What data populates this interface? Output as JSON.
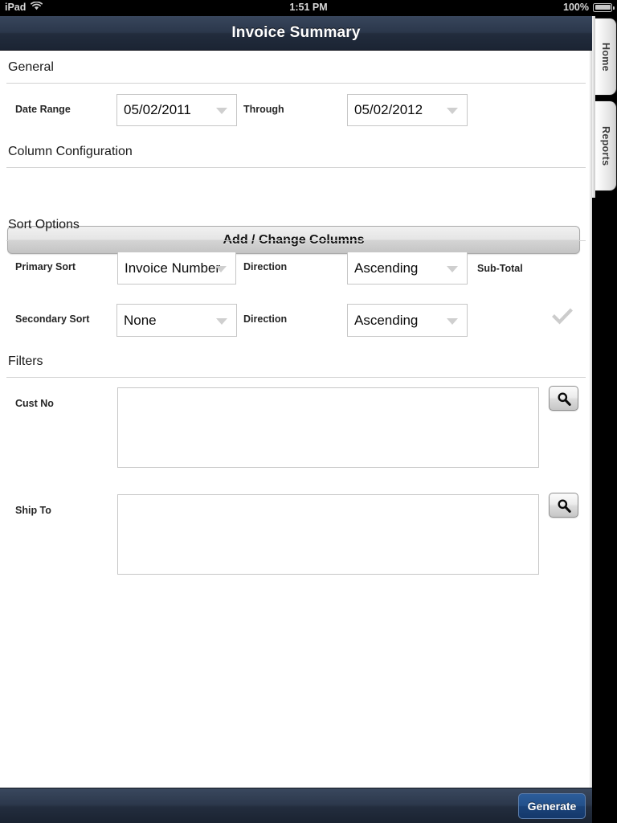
{
  "status_bar": {
    "carrier": "iPad",
    "wifi_icon": "wifi-icon",
    "time": "1:51 PM",
    "battery_percent": "100%",
    "battery_icon": "battery-full-icon"
  },
  "nav": {
    "title": "Invoice Summary"
  },
  "side_tabs": [
    {
      "label": "Home"
    },
    {
      "label": "Reports"
    }
  ],
  "sections": {
    "general": {
      "title": "General",
      "date_range_label": "Date Range",
      "date_from": "05/02/2011",
      "through_label": "Through",
      "date_to": "05/02/2012"
    },
    "column_configuration": {
      "title": "Column Configuration",
      "button_label": "Add / Change Columns"
    },
    "sort_options": {
      "title": "Sort Options",
      "primary_sort_label": "Primary Sort",
      "primary_sort_value": "Invoice Number",
      "primary_direction_label": "Direction",
      "primary_direction_value": "Ascending",
      "sub_total_label": "Sub-Total",
      "sub_total_icon": "checkmark-icon",
      "secondary_sort_label": "Secondary Sort",
      "secondary_sort_value": "None",
      "secondary_direction_label": "Direction",
      "secondary_direction_value": "Ascending"
    },
    "filters": {
      "title": "Filters",
      "cust_no_label": "Cust No",
      "cust_no_value": "",
      "cust_no_search_icon": "search-icon",
      "ship_to_label": "Ship To",
      "ship_to_value": "",
      "ship_to_search_icon": "search-icon"
    }
  },
  "toolbar": {
    "generate_label": "Generate"
  },
  "colors": {
    "nav_bar": "#2b374b",
    "accent_button": "#23508a",
    "panel": "#ffffff",
    "rule": "#d2d2d2"
  }
}
